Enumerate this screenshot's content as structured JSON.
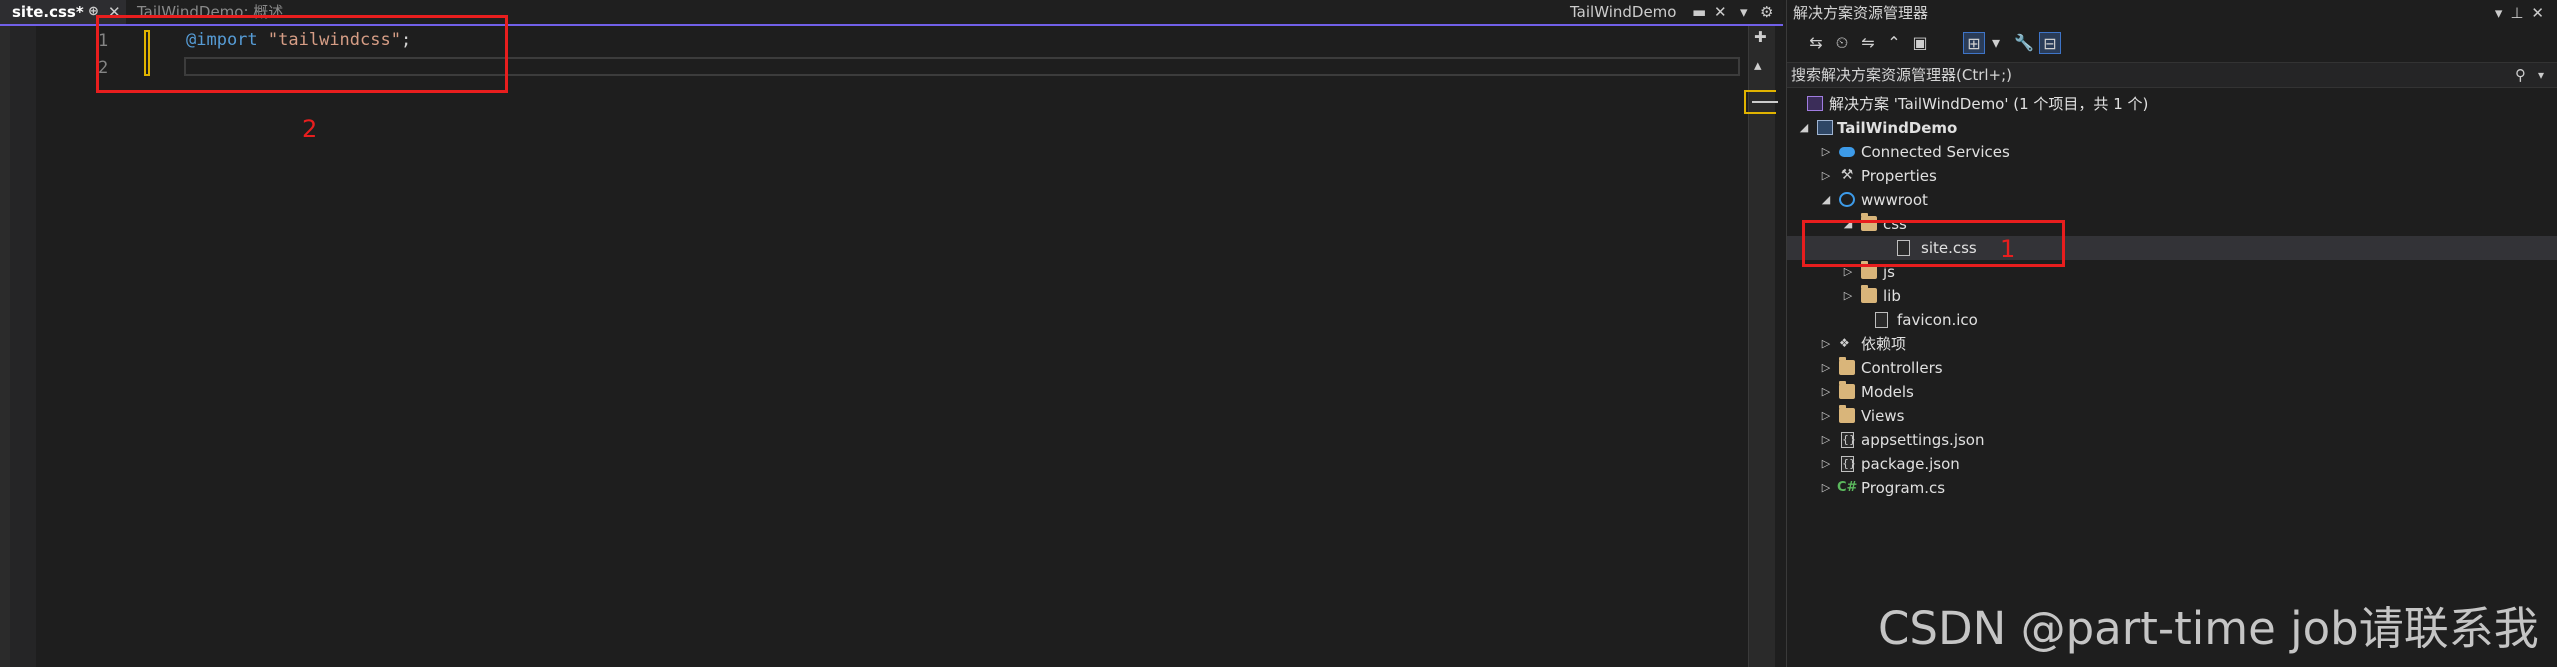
{
  "tabs": {
    "active": "site.css*",
    "active_pin": "⊕",
    "active_close": "✕",
    "inactive": "TailWindDemo: 概述"
  },
  "top_right": {
    "label": "TailWindDemo",
    "icons": [
      "▬",
      "✕",
      "▾",
      "⚙"
    ]
  },
  "editor": {
    "lines": [
      {
        "number": "1",
        "keyword": "@import",
        "string": "\"tailwindcss\"",
        "punct": ";"
      },
      {
        "number": "2",
        "keyword": "",
        "string": "",
        "punct": ""
      }
    ],
    "scroll_add": "✚",
    "scroll_up": "▴"
  },
  "annotations": {
    "box_editor_label": "2",
    "box_file_label": "1",
    "color": "#e81e1e"
  },
  "solution_explorer": {
    "title": "解决方案资源管理器",
    "title_icons": [
      "▾",
      "⊥",
      "✕"
    ],
    "toolbar_icons": [
      "⇆",
      "⏲",
      "⇋",
      "⌃",
      "▣",
      "⊞",
      "▾",
      "🔧",
      "⊟"
    ],
    "search_placeholder": "搜索解决方案资源管理器(Ctrl+;)",
    "search_icon": "⚲",
    "search_drop": "▾",
    "tree": [
      {
        "label": "解决方案 'TailWindDemo' (1 个项目，共 1 个)",
        "type": "solution",
        "depth": 0,
        "arrow": ""
      },
      {
        "label": "TailWindDemo",
        "type": "project",
        "depth": 0,
        "arrow": "◢",
        "bold": true
      },
      {
        "label": "Connected Services",
        "type": "connected",
        "depth": 1,
        "arrow": "▷"
      },
      {
        "label": "Properties",
        "type": "properties",
        "depth": 1,
        "arrow": "▷"
      },
      {
        "label": "wwwroot",
        "type": "globe",
        "depth": 1,
        "arrow": "◢"
      },
      {
        "label": "css",
        "type": "folder",
        "depth": 2,
        "arrow": "◢"
      },
      {
        "label": "site.css",
        "type": "file",
        "depth": 3,
        "arrow": "",
        "selected": true
      },
      {
        "label": "js",
        "type": "folder",
        "depth": 2,
        "arrow": "▷"
      },
      {
        "label": "lib",
        "type": "folder",
        "depth": 2,
        "arrow": "▷"
      },
      {
        "label": "favicon.ico",
        "type": "file",
        "depth": 2,
        "arrow": ""
      },
      {
        "label": "依赖项",
        "type": "dependencies",
        "depth": 1,
        "arrow": "▷"
      },
      {
        "label": "Controllers",
        "type": "folder",
        "depth": 1,
        "arrow": "▷"
      },
      {
        "label": "Models",
        "type": "folder",
        "depth": 1,
        "arrow": "▷"
      },
      {
        "label": "Views",
        "type": "folder",
        "depth": 1,
        "arrow": "▷"
      },
      {
        "label": "appsettings.json",
        "type": "json",
        "depth": 1,
        "arrow": "▷"
      },
      {
        "label": "package.json",
        "type": "json",
        "depth": 1,
        "arrow": "▷"
      },
      {
        "label": "Program.cs",
        "type": "csharp",
        "depth": 1,
        "arrow": "▷"
      }
    ]
  },
  "watermark": "CSDN @part-time job请联系我"
}
